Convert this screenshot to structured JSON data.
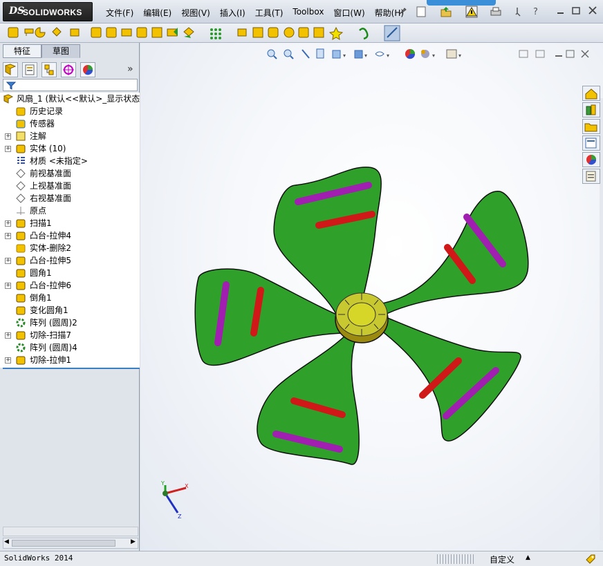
{
  "app": {
    "logo_text": "SOLIDWORKS",
    "logo_ds": "DS"
  },
  "menu": [
    "文件(F)",
    "编辑(E)",
    "视图(V)",
    "插入(I)",
    "工具(T)",
    "Toolbox",
    "窗口(W)",
    "帮助(H)"
  ],
  "panel_tabs": [
    "特征",
    "草图"
  ],
  "tree": {
    "root": "风扇_1   (默认<<默认>_显示状态",
    "items": [
      {
        "label": "历史记录",
        "icon": "history-icon",
        "expandable": false
      },
      {
        "label": "传感器",
        "icon": "sensor-icon",
        "expandable": false
      },
      {
        "label": "注解",
        "icon": "annotation-icon",
        "expandable": true
      },
      {
        "label": "实体 (10)",
        "icon": "solid-bodies-icon",
        "expandable": true
      },
      {
        "label": "材质 <未指定>",
        "icon": "material-icon",
        "expandable": false
      },
      {
        "label": "前视基准面",
        "icon": "plane-icon",
        "expandable": false
      },
      {
        "label": "上视基准面",
        "icon": "plane-icon",
        "expandable": false
      },
      {
        "label": "右视基准面",
        "icon": "plane-icon",
        "expandable": false
      },
      {
        "label": "原点",
        "icon": "origin-icon",
        "expandable": false
      },
      {
        "label": "扫描1",
        "icon": "sweep-icon",
        "expandable": true
      },
      {
        "label": "凸台-拉伸4",
        "icon": "extrude-icon",
        "expandable": true
      },
      {
        "label": "实体-删除2",
        "icon": "delete-body-icon",
        "expandable": false
      },
      {
        "label": "凸台-拉伸5",
        "icon": "extrude-icon",
        "expandable": true
      },
      {
        "label": "圆角1",
        "icon": "fillet-icon",
        "expandable": false
      },
      {
        "label": "凸台-拉伸6",
        "icon": "extrude-icon",
        "expandable": true
      },
      {
        "label": "倒角1",
        "icon": "chamfer-icon",
        "expandable": false
      },
      {
        "label": "变化圆角1",
        "icon": "variable-fillet-icon",
        "expandable": false
      },
      {
        "label": "阵列 (圆周)2",
        "icon": "circular-pattern-icon",
        "expandable": false
      },
      {
        "label": "切除-扫描7",
        "icon": "cut-sweep-icon",
        "expandable": true
      },
      {
        "label": "阵列 (圆周)4",
        "icon": "circular-pattern-icon",
        "expandable": false
      },
      {
        "label": "切除-拉伸1",
        "icon": "cut-extrude-icon",
        "expandable": true
      }
    ]
  },
  "status": {
    "left": "SolidWorks 2014",
    "units": "自定义"
  },
  "triad": {
    "x": "X",
    "y": "Y",
    "z": "Z"
  },
  "colors": {
    "blade_green": "#2fa02a",
    "slot_purple": "#a01fb0",
    "slot_red": "#d01818",
    "hub_yellow": "#c8c830"
  }
}
